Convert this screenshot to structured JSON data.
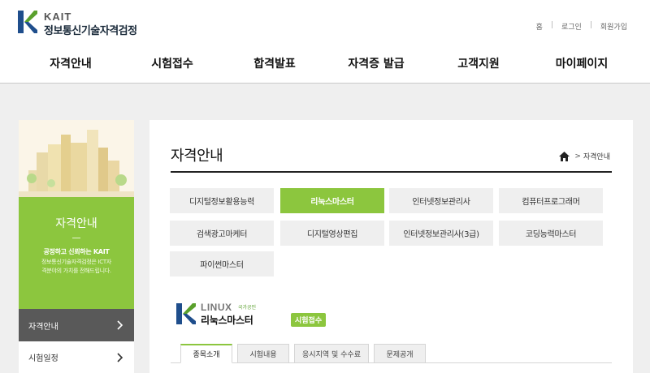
{
  "header": {
    "logo_en": "KAIT",
    "logo_ko": "정보통신기술자격검정",
    "util": [
      "홈",
      "로그인",
      "회원가입"
    ],
    "util_sep": "|",
    "gnb": [
      "자격안내",
      "시험접수",
      "합격발표",
      "자격증 발급",
      "고객지원",
      "마이페이지"
    ]
  },
  "sidebar": {
    "title": "자격안내",
    "sub1": "공정하고 신뢰하는 KAIT",
    "sub2": "정보통신기술자격검정은 ICT자격분야의 가치를 전해드립니다.",
    "items": [
      {
        "label": "자격안내",
        "active": true
      },
      {
        "label": "시험일정",
        "active": false
      }
    ]
  },
  "main": {
    "title": "자격안내",
    "breadcrumb": "자격안내",
    "breadcrumb_sep": ">",
    "qualifications": [
      {
        "label": "디지털정보활용능력",
        "active": false
      },
      {
        "label": "리눅스마스터",
        "active": true
      },
      {
        "label": "인터넷정보관리사",
        "active": false
      },
      {
        "label": "컴퓨터프로그래머",
        "active": false
      },
      {
        "label": "검색광고마케터",
        "active": false
      },
      {
        "label": "디지털영상편집",
        "active": false
      },
      {
        "label": "인터넷정보관리사(3급)",
        "active": false
      },
      {
        "label": "코딩능력마스터",
        "active": false
      },
      {
        "label": "파이썬마스터",
        "active": false
      }
    ],
    "product": {
      "en": "LINUX",
      "en_tag": "국가공인",
      "ko": "리눅스마스터",
      "badge": "시험접수"
    },
    "tabs": [
      {
        "label": "종목소개",
        "active": true
      },
      {
        "label": "시험내용",
        "active": false
      },
      {
        "label": "응시지역 및 수수료",
        "active": false
      },
      {
        "label": "문제공개",
        "active": false
      }
    ]
  },
  "colors": {
    "accent_green": "#8cc63e",
    "logo_blue": "#1f4e8c",
    "logo_green": "#5aa02c",
    "active_sidebar": "#595959"
  }
}
